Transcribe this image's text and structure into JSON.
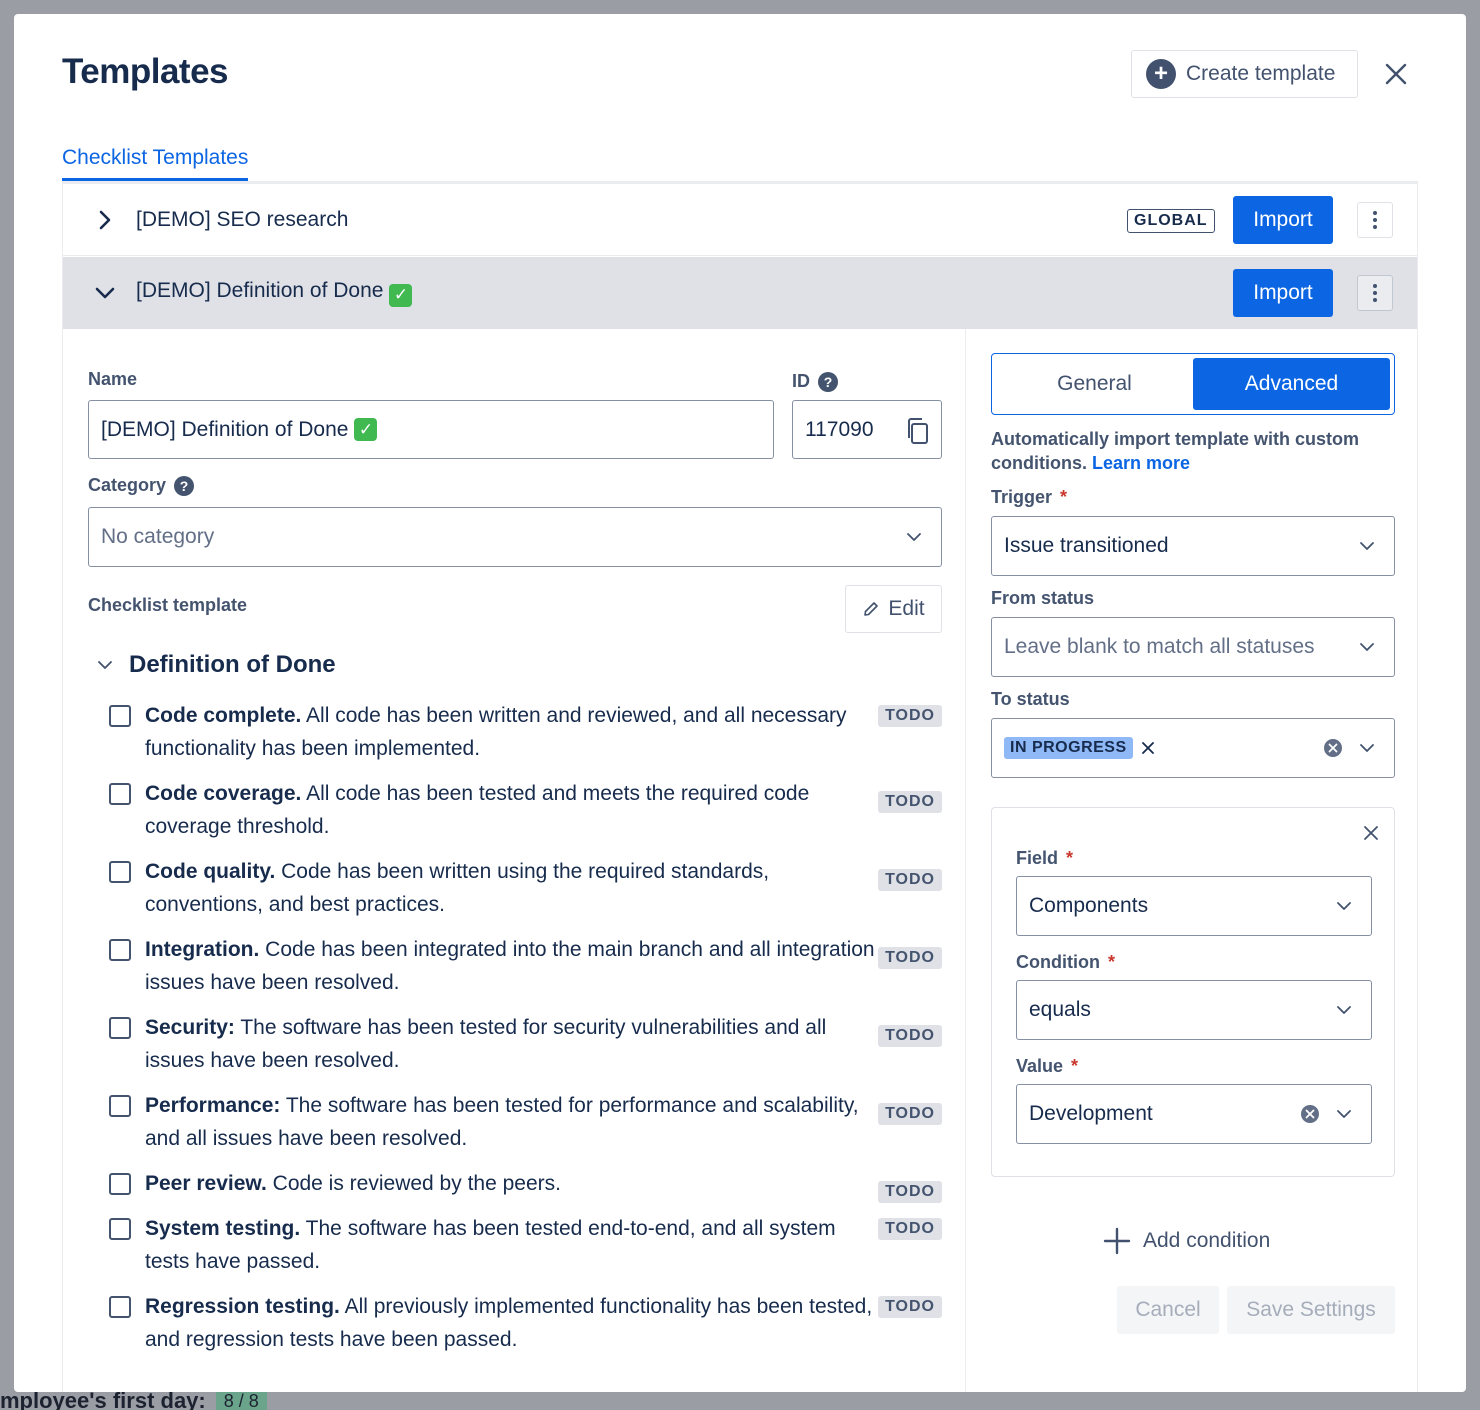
{
  "modal": {
    "title": "Templates",
    "create_label": "Create template",
    "tab_label": "Checklist Templates"
  },
  "backdrop": {
    "bottom_text": "mployee's first day:",
    "bottom_badge": "8 / 8"
  },
  "templates": [
    {
      "name": "[DEMO] SEO research",
      "badge": "GLOBAL",
      "import_label": "Import",
      "expanded": false
    },
    {
      "name": "[DEMO] Definition of Done",
      "import_label": "Import",
      "expanded": true
    }
  ],
  "form": {
    "name_label": "Name",
    "name_value": "[DEMO] Definition of Done",
    "id_label": "ID",
    "id_value": "117090",
    "category_label": "Category",
    "category_placeholder": "No category",
    "checklist_label": "Checklist template",
    "edit_label": "Edit"
  },
  "checklist": {
    "section": "Definition of Done",
    "todo_label": "TODO",
    "items": [
      {
        "title": "Code complete.",
        "text": " All code has been written and reviewed, and all necessary functionality has been implemented."
      },
      {
        "title": "Code coverage.",
        "text": " All code has been tested and meets the required code coverage threshold."
      },
      {
        "title": "Code quality.",
        "text": " Code has been written using the required standards, conventions, and best practices."
      },
      {
        "title": "Integration.",
        "text": " Code has been integrated into the main branch and all integration issues have been resolved."
      },
      {
        "title": "Security:",
        "text": " The software has been tested for security vulnerabilities and all issues have been resolved."
      },
      {
        "title": "Performance:",
        "text": " The software has been tested for performance and scalability, and all issues have been resolved."
      },
      {
        "title": "Peer review.",
        "text": " Code is reviewed by the peers."
      },
      {
        "title": "System testing.",
        "text": " The software has been tested end-to-end, and all system tests have passed."
      },
      {
        "title": "Regression testing.",
        "text": " All previously implemented functionality has been tested, and regression tests have been passed."
      }
    ]
  },
  "settings": {
    "tab_general": "General",
    "tab_advanced": "Advanced",
    "description": "Automatically import template with custom conditions.",
    "learn_more": "Learn more",
    "trigger_label": "Trigger",
    "trigger_value": "Issue transitioned",
    "from_label": "From status",
    "from_placeholder": "Leave blank to match all statuses",
    "to_label": "To status",
    "to_value": "IN PROGRESS",
    "field_label": "Field",
    "field_value": "Components",
    "condition_label": "Condition",
    "condition_value": "equals",
    "value_label": "Value",
    "value_value": "Development",
    "add_condition": "Add condition",
    "cancel": "Cancel",
    "save": "Save Settings"
  },
  "colors": {
    "primary": "#0c66e4",
    "text": "#172b4d",
    "required": "#c9372c"
  }
}
